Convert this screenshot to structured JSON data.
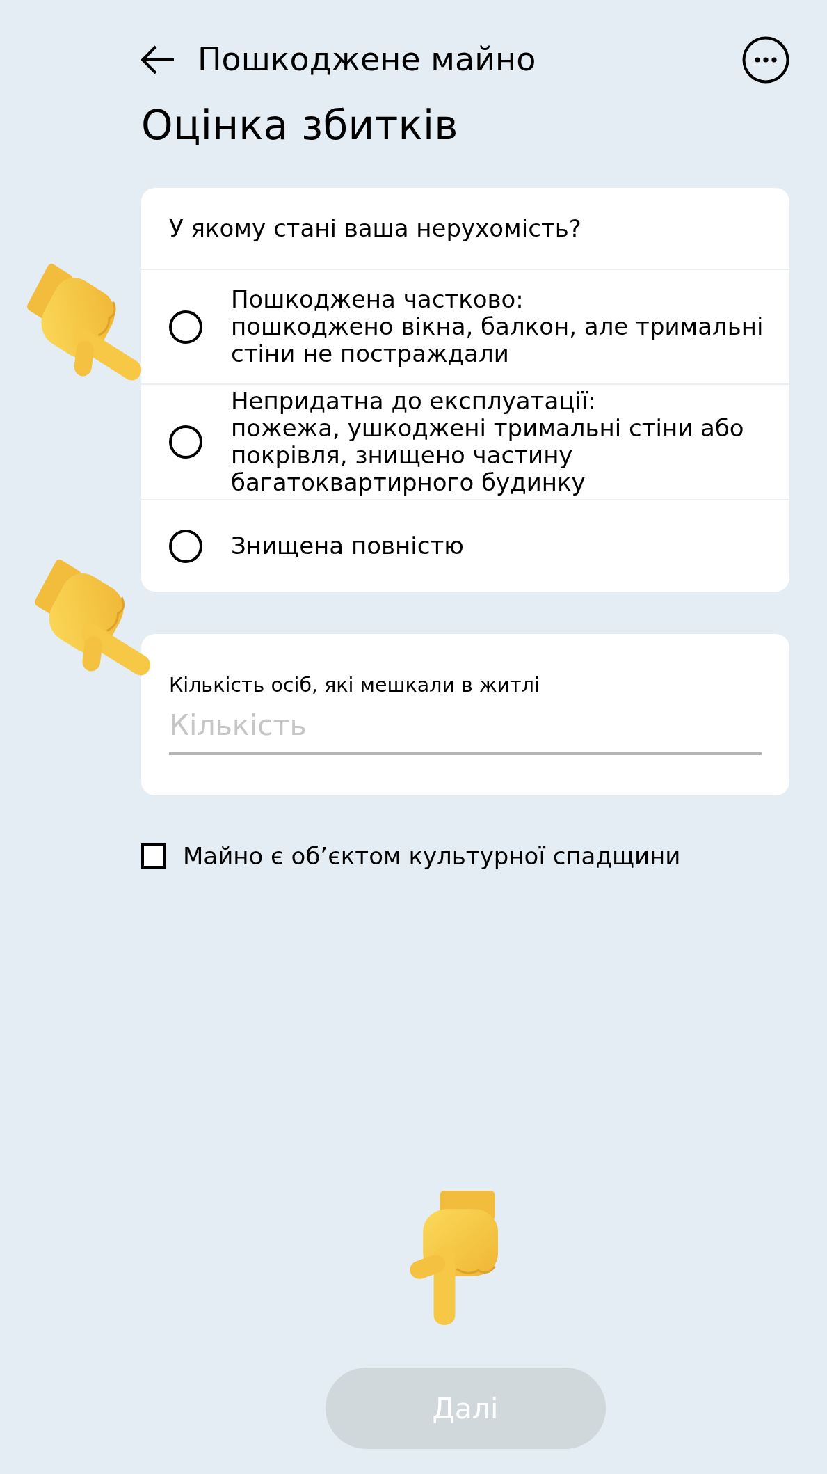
{
  "header": {
    "title": "Пошкоджене майно"
  },
  "heading": "Оцінка збитків",
  "condition_card": {
    "question": "У якому стані ваша нерухомість?",
    "options": [
      {
        "title": "Пошкоджена частково:",
        "description": "пошкоджено вікна, балкон, але тримальні стіни не постраждали",
        "selected": false
      },
      {
        "title": "Непридатна до експлуатації:",
        "description": "пожежа, ушкоджені тримальні стіни або покрівля, знищено частину багатоквартирного будинку",
        "selected": false
      },
      {
        "title": "Знищена повністю",
        "selected": false
      }
    ]
  },
  "residents_card": {
    "label": "Кількість осіб, які мешкали в житлі",
    "placeholder": "Кількість"
  },
  "heritage_checkbox": {
    "label": "Майно є об’єктом культурної спадщини",
    "checked": false
  },
  "next_button": {
    "label": "Далі",
    "disabled": true
  }
}
